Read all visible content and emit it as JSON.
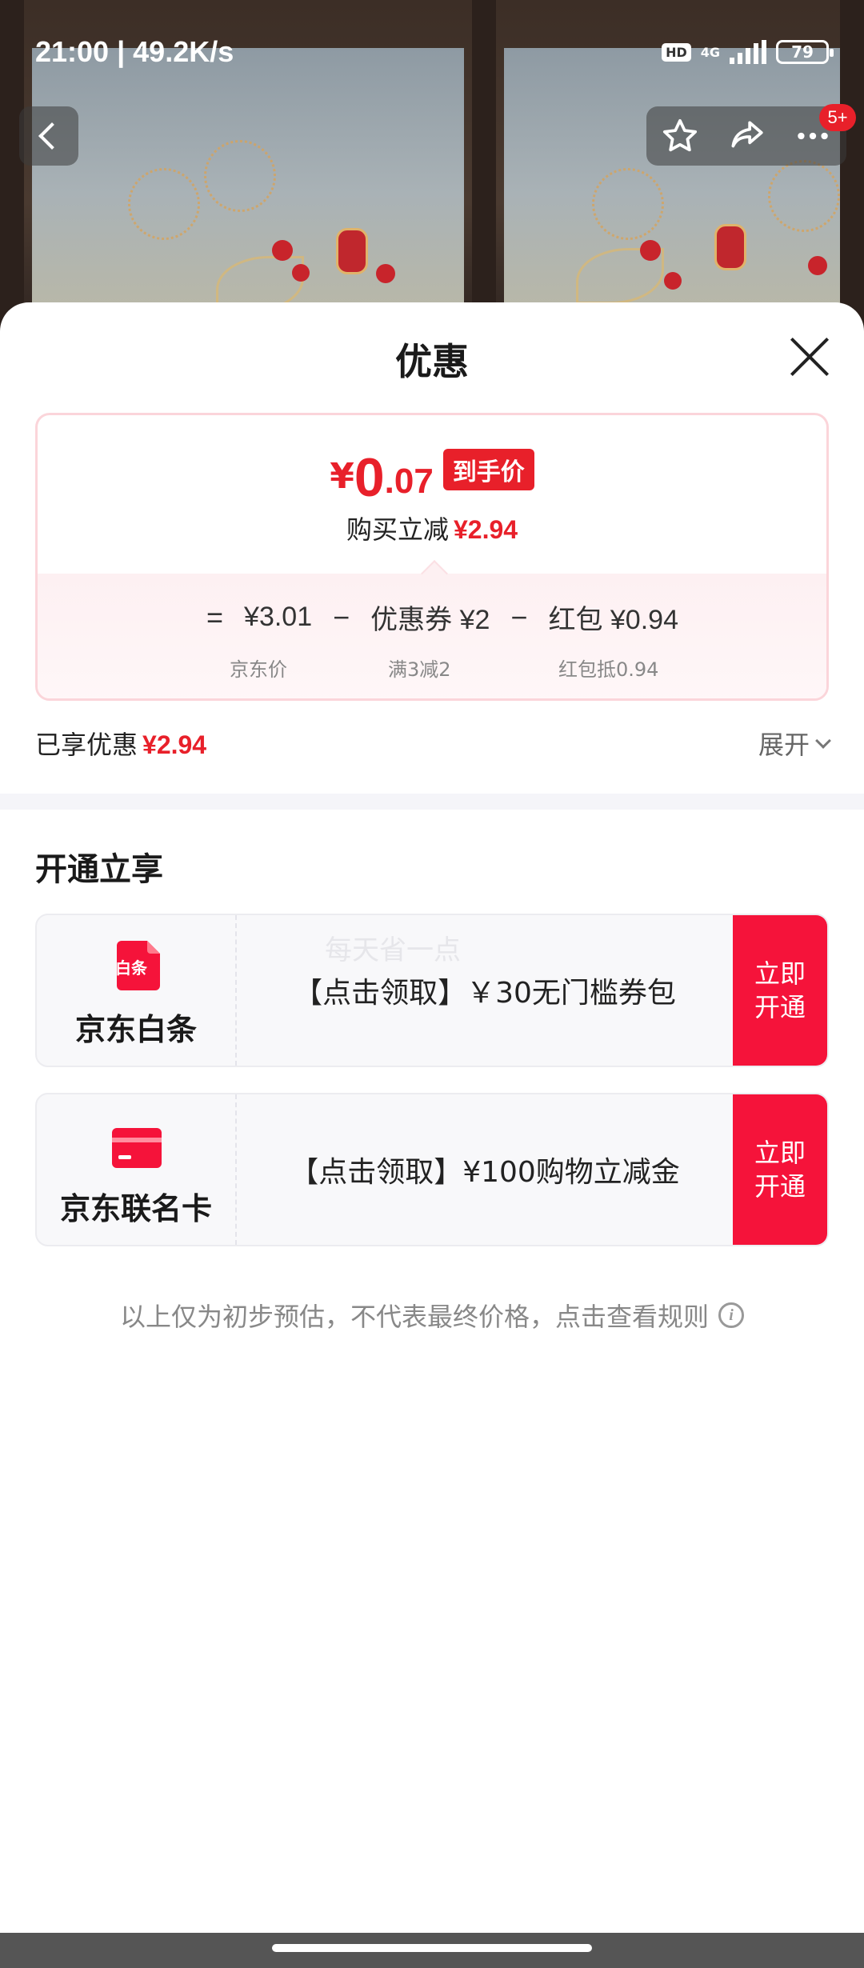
{
  "status_bar": {
    "time": "21:00 | 49.2K/s",
    "hd": "HD",
    "network": "4G",
    "battery": "79"
  },
  "header_actions": {
    "more_badge": "5+"
  },
  "sheet": {
    "title": "优惠"
  },
  "price_card": {
    "currency": "¥",
    "price_integer": "0",
    "price_decimal": ".07",
    "price_tag": "到手价",
    "reduce_label": "购买立减",
    "reduce_amount": "¥2.94",
    "formula": {
      "equals": "=",
      "jd_price": "¥3.01",
      "minus1": "−",
      "coupon": "优惠券 ¥2",
      "minus2": "−",
      "red_packet": "红包 ¥0.94"
    },
    "sub_labels": {
      "jd_price": "京东价",
      "coupon": "满3减2",
      "red_packet": "红包抵0.94"
    }
  },
  "enjoyed": {
    "label": "已享优惠",
    "amount": "¥2.94",
    "expand_label": "展开"
  },
  "open_section": {
    "title": "开通立享",
    "watermark": "每天省一点",
    "offers": [
      {
        "name": "京东白条",
        "icon": "baitiao-icon",
        "icon_text": "白条",
        "text": "【点击领取】￥30无门槛券包",
        "button": "立即开通"
      },
      {
        "name": "京东联名卡",
        "icon": "credit-card-icon",
        "text": "【点击领取】¥100购物立减金",
        "button": "立即开通"
      }
    ]
  },
  "disclaimer": "以上仅为初步预估，不代表最终价格，点击查看规则",
  "colors": {
    "accent": "#e8202a",
    "button": "#f5133a",
    "card_border": "#fbd5da",
    "band": "#f5f5f9"
  }
}
